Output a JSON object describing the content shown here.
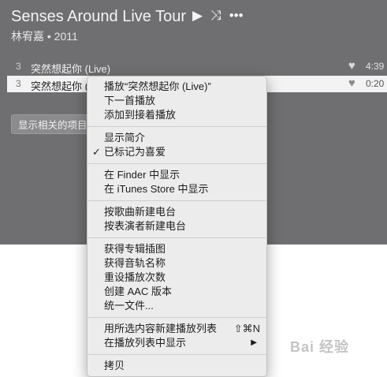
{
  "album": {
    "title": "Senses Around Live Tour",
    "subtitle": "林宥嘉 • 2011",
    "actions": {
      "play": "▶",
      "shuffle": "⤨",
      "more": "•••"
    }
  },
  "tracks": [
    {
      "number": "3",
      "name": "突然想起你 (Live)",
      "heart": "♥",
      "time": "4:39"
    },
    {
      "number": "3",
      "name": "突然想起你 (",
      "heart": "♥",
      "time": "0:20"
    }
  ],
  "related_button": "显示相关的项目",
  "context_menu": {
    "groups": [
      [
        {
          "label": "播放“突然想起你 (Live)”"
        },
        {
          "label": "下一首播放"
        },
        {
          "label": "添加到接着播放"
        }
      ],
      [
        {
          "label": "显示简介"
        },
        {
          "label": "已标记为喜爱",
          "check": "✓"
        }
      ],
      [
        {
          "label": "在 Finder 中显示"
        },
        {
          "label": "在 iTunes Store 中显示"
        }
      ],
      [
        {
          "label": "按歌曲新建电台"
        },
        {
          "label": "按表演者新建电台"
        }
      ],
      [
        {
          "label": "获得专辑插图"
        },
        {
          "label": "获得音轨名称"
        },
        {
          "label": "重设播放次数"
        },
        {
          "label": "创建 AAC 版本"
        },
        {
          "label": "统一文件..."
        }
      ],
      [
        {
          "label": "用所选内容新建播放列表",
          "shortcut": "⇧⌘N"
        },
        {
          "label": "在播放列表中显示",
          "arrow": "▶"
        }
      ],
      [
        {
          "label": "拷贝"
        }
      ]
    ]
  },
  "watermark": "Bai 经验"
}
